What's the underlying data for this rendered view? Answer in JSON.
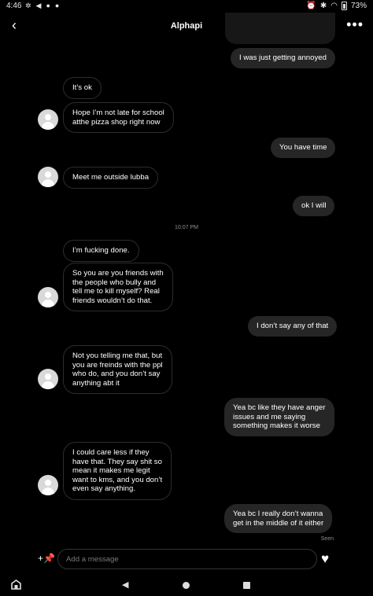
{
  "status_bar": {
    "time": "4:46",
    "battery": "73%"
  },
  "header": {
    "title": "Alphapi"
  },
  "messages": [
    {
      "side": "out",
      "text": "I was just getting annoyed"
    },
    {
      "side": "in",
      "text": "It’s ok"
    },
    {
      "side": "in",
      "text": "Hope I’m not late for school\natthe pizza shop right now"
    },
    {
      "side": "out",
      "text": "You have time"
    },
    {
      "side": "in",
      "text": "Meet me outside lubba"
    },
    {
      "side": "out",
      "text": "ok I will"
    },
    {
      "side": "in",
      "text": "I’m fucking done."
    },
    {
      "side": "in",
      "text": "So you are you friends with\nthe people who bully and\ntell me to kill myself? Real\nfriends wouldn’t do that."
    },
    {
      "side": "out",
      "text": "I don’t say any of that"
    },
    {
      "side": "in",
      "text": "Not you telling me that, but\nyou are freinds with the ppl\nwho do, and you don’t say\nanything abt it"
    },
    {
      "side": "out",
      "text": "Yea bc like they have anger\nissues and me saying\nsomething makes it worse"
    },
    {
      "side": "in",
      "text": "I could care less if they\nhave that. They say shit so\nmean it makes me legit\nwant to kms, and you don’t\neven say anything."
    },
    {
      "side": "out",
      "text": "Yea bc I really don’t wanna\nget in the middle of it either"
    }
  ],
  "timestamp": "10:07 PM",
  "seen_label": "Seen",
  "composer": {
    "placeholder": "Add a message"
  },
  "icons": {
    "back": "chevron-left-icon",
    "more": "more-horizontal-icon",
    "pin": "add-pin-icon",
    "heart": "heart-icon"
  }
}
